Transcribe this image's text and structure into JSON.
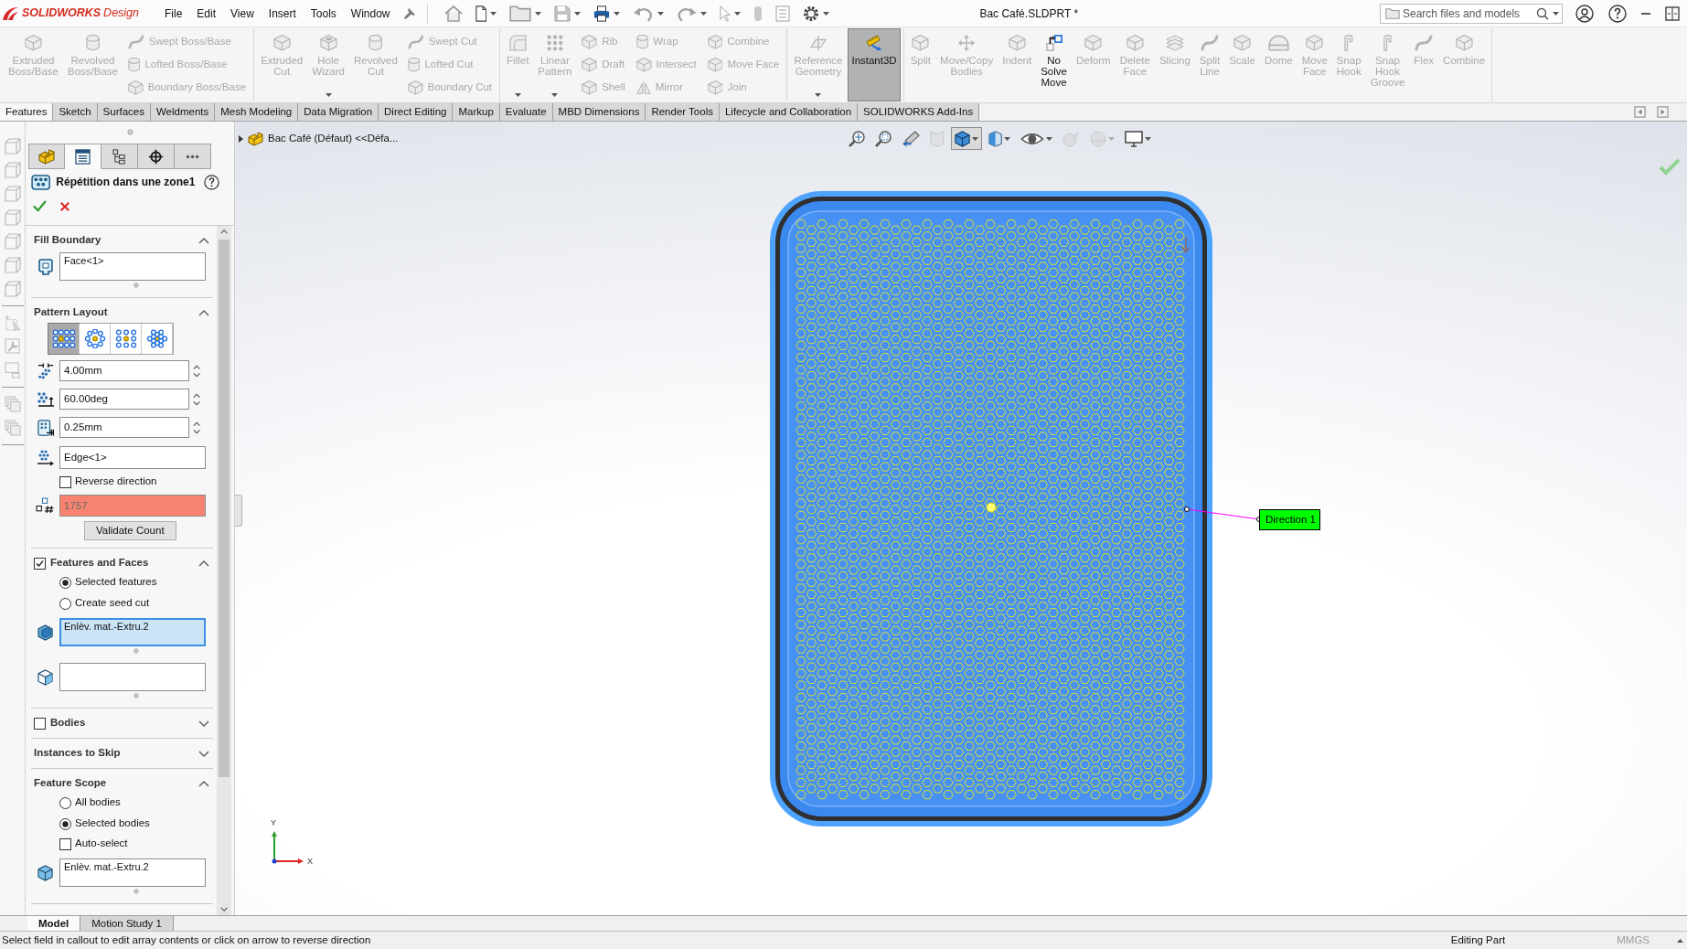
{
  "title_bar": {
    "logo": {
      "brand": "SOLIDWORKS",
      "product": "Design"
    },
    "menu": [
      "File",
      "Edit",
      "View",
      "Insert",
      "Tools",
      "Window"
    ],
    "document_title": "Bac Café.SLDPRT *",
    "search": {
      "placeholder": "Search files and models"
    }
  },
  "ribbon": {
    "groups": [
      {
        "commands": [
          {
            "kind": "button",
            "label": "Extruded Boss/Base",
            "disabled": true
          },
          {
            "kind": "button",
            "label": "Revolved Boss/Base",
            "disabled": true
          },
          {
            "kind": "stack",
            "items": [
              {
                "label": "Swept Boss/Base",
                "disabled": true
              },
              {
                "label": "Lofted Boss/Base",
                "disabled": true
              },
              {
                "label": "Boundary Boss/Base",
                "disabled": true
              }
            ]
          }
        ]
      },
      {
        "commands": [
          {
            "kind": "button",
            "label": "Extruded Cut",
            "disabled": true
          },
          {
            "kind": "menu_button",
            "label": "Hole Wizard",
            "disabled": true
          },
          {
            "kind": "button",
            "label": "Revolved Cut",
            "disabled": true
          },
          {
            "kind": "stack",
            "items": [
              {
                "label": "Swept Cut",
                "disabled": true
              },
              {
                "label": "Lofted Cut",
                "disabled": true
              },
              {
                "label": "Boundary Cut",
                "disabled": true
              }
            ]
          }
        ]
      },
      {
        "commands": [
          {
            "kind": "menu_button",
            "label": "Fillet",
            "disabled": true
          },
          {
            "kind": "menu_button",
            "label": "Linear Pattern",
            "disabled": true
          },
          {
            "kind": "stack",
            "items": [
              {
                "label": "Rib",
                "disabled": true
              },
              {
                "label": "Draft",
                "disabled": true
              },
              {
                "label": "Shell",
                "disabled": true
              }
            ]
          },
          {
            "kind": "stack",
            "items": [
              {
                "label": "Wrap",
                "disabled": true
              },
              {
                "label": "Intersect",
                "disabled": true
              },
              {
                "label": "Mirror",
                "disabled": true
              }
            ]
          },
          {
            "kind": "stack",
            "items": [
              {
                "label": "Combine",
                "disabled": true
              },
              {
                "label": "Move Face",
                "disabled": true
              },
              {
                "label": "Join",
                "disabled": true
              }
            ]
          }
        ]
      },
      {
        "commands": [
          {
            "kind": "menu_button",
            "label": "Reference Geometry",
            "disabled": true
          },
          {
            "kind": "toggle",
            "label": "Instant3D",
            "disabled": false,
            "on": true
          }
        ]
      },
      {
        "commands": [
          {
            "kind": "button",
            "label": "Split",
            "disabled": true
          },
          {
            "kind": "button",
            "label": "Move/Copy Bodies",
            "disabled": true
          },
          {
            "kind": "button",
            "label": "Indent",
            "disabled": true
          },
          {
            "kind": "button",
            "label": "No Solve Move",
            "disabled": false
          },
          {
            "kind": "button",
            "label": "Deform",
            "disabled": true
          },
          {
            "kind": "button",
            "label": "Delete Face",
            "disabled": true
          },
          {
            "kind": "button",
            "label": "Slicing",
            "disabled": true
          },
          {
            "kind": "button",
            "label": "Split Line",
            "disabled": true
          },
          {
            "kind": "button",
            "label": "Scale",
            "disabled": true
          },
          {
            "kind": "button",
            "label": "Dome",
            "disabled": true
          },
          {
            "kind": "button",
            "label": "Move Face",
            "disabled": true
          },
          {
            "kind": "button",
            "label": "Snap Hook",
            "disabled": true
          },
          {
            "kind": "button",
            "label": "Snap Hook Groove",
            "disabled": true
          },
          {
            "kind": "button",
            "label": "Flex",
            "disabled": true
          },
          {
            "kind": "button",
            "label": "Combine",
            "disabled": true
          }
        ]
      }
    ]
  },
  "tabs": [
    {
      "label": "Features",
      "selected": true
    },
    {
      "label": "Sketch",
      "selected": false
    },
    {
      "label": "Surfaces",
      "selected": false
    },
    {
      "label": "Weldments",
      "selected": false
    },
    {
      "label": "Mesh Modeling",
      "selected": false
    },
    {
      "label": "Data Migration",
      "selected": false
    },
    {
      "label": "Direct Editing",
      "selected": false
    },
    {
      "label": "Markup",
      "selected": false
    },
    {
      "label": "Evaluate",
      "selected": false
    },
    {
      "label": "MBD Dimensions",
      "selected": false
    },
    {
      "label": "Render Tools",
      "selected": false
    },
    {
      "label": "Lifecycle and Collaboration",
      "selected": false
    },
    {
      "label": "SOLIDWORKS Add-Ins",
      "selected": false
    }
  ],
  "property_manager": {
    "tabs": [
      {
        "selected": false
      },
      {
        "selected": true
      },
      {
        "selected": false
      },
      {
        "selected": false
      },
      {
        "selected": false
      }
    ],
    "title": "Répétition dans une zone1",
    "sections": [
      {
        "kind": "group",
        "title": "Fill Boundary",
        "expanded": true,
        "controls": [
          {
            "kind": "list",
            "value": "Face<1>",
            "active": false
          }
        ]
      },
      {
        "kind": "group",
        "title": "Pattern Layout",
        "expanded": true,
        "controls": [
          {
            "kind": "layouts",
            "options": [
              {
                "selected": true
              },
              {
                "selected": false
              },
              {
                "selected": false
              },
              {
                "selected": false
              }
            ]
          },
          {
            "kind": "spin",
            "value": "4.00mm"
          },
          {
            "kind": "spin",
            "value": "60.00deg"
          },
          {
            "kind": "spin",
            "value": "0.25mm"
          },
          {
            "kind": "field",
            "value": "Edge<1>"
          },
          {
            "kind": "checkbox",
            "label": "Reverse direction",
            "checked": false
          },
          {
            "kind": "count",
            "value": "1757",
            "error": true
          },
          {
            "kind": "button",
            "label": "Validate Count"
          }
        ]
      },
      {
        "kind": "check_group",
        "title": "Features and Faces",
        "checked": true,
        "expanded": true,
        "controls": [
          {
            "kind": "radio",
            "label": "Selected features",
            "selected": true
          },
          {
            "kind": "radio",
            "label": "Create seed cut",
            "selected": false
          },
          {
            "kind": "list",
            "value": "Enlèv. mat.-Extru.2",
            "active": true
          },
          {
            "kind": "list",
            "active": false
          }
        ]
      },
      {
        "kind": "check_group",
        "title": "Bodies",
        "checked": false,
        "expanded": false
      },
      {
        "kind": "group",
        "title": "Instances to Skip",
        "expanded": false
      },
      {
        "kind": "group",
        "title": "Feature Scope",
        "expanded": true,
        "controls": [
          {
            "kind": "radio",
            "label": "All bodies",
            "selected": false
          },
          {
            "kind": "radio",
            "label": "Selected bodies",
            "selected": true
          },
          {
            "kind": "checkbox",
            "label": "Auto-select",
            "checked": false
          },
          {
            "kind": "list",
            "value": "Enlèv. mat.-Extru.2",
            "active": false
          }
        ]
      }
    ]
  },
  "feature_tree": {
    "root": {
      "label": "Bac Café (Défaut) <<Défa...",
      "expanded": false
    }
  },
  "view_toolbar": [
    {
      "kind": "button",
      "selected": false,
      "disabled": false
    },
    {
      "kind": "button",
      "selected": false,
      "disabled": false
    },
    {
      "kind": "button",
      "selected": false,
      "disabled": false
    },
    {
      "kind": "button",
      "selected": false,
      "disabled": true
    },
    {
      "kind": "menu_button",
      "selected": true,
      "disabled": false
    },
    {
      "kind": "menu_button",
      "selected": false,
      "disabled": false
    },
    {
      "kind": "menu_button",
      "selected": false,
      "disabled": false
    },
    {
      "kind": "button",
      "selected": false,
      "disabled": true
    },
    {
      "kind": "menu_button",
      "selected": false,
      "disabled": true
    },
    {
      "kind": "menu_button",
      "selected": false,
      "disabled": false
    }
  ],
  "viewport": {
    "callout": "Direction 1",
    "axis_labels": [
      "Y",
      "X"
    ]
  },
  "bottom_tabs": [
    {
      "label": "Model",
      "selected": true
    },
    {
      "label": "Motion Study 1",
      "selected": false
    }
  ],
  "status_bar": {
    "message": "Select field in callout to edit array contents or click on arrow to reverse direction",
    "mode": "Editing Part",
    "units": "MMGS"
  }
}
